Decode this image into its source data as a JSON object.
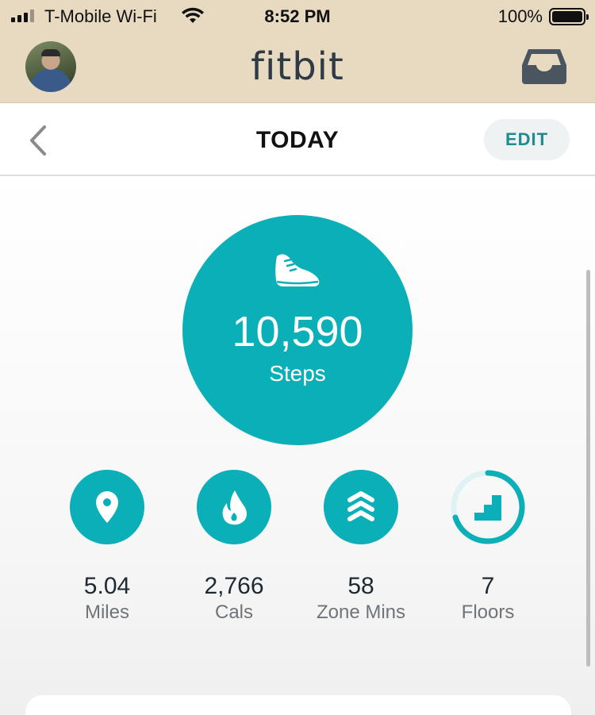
{
  "status_bar": {
    "carrier": "T-Mobile Wi-Fi",
    "time": "8:52 PM",
    "battery": "100%"
  },
  "header": {
    "logo": "fitbit"
  },
  "nav": {
    "title": "TODAY",
    "edit_label": "EDIT"
  },
  "steps": {
    "value": "10,590",
    "label": "Steps"
  },
  "stats": [
    {
      "value": "5.04",
      "label": "Miles",
      "icon": "location-pin-icon"
    },
    {
      "value": "2,766",
      "label": "Cals",
      "icon": "flame-icon"
    },
    {
      "value": "58",
      "label": "Zone Mins",
      "icon": "chevrons-up-icon"
    },
    {
      "value": "7",
      "label": "Floors",
      "icon": "stairs-icon",
      "progress": 0.7
    }
  ],
  "colors": {
    "accent": "#0aafb8",
    "header_bg": "#e8dac1",
    "edit_text": "#1f8a8f"
  }
}
